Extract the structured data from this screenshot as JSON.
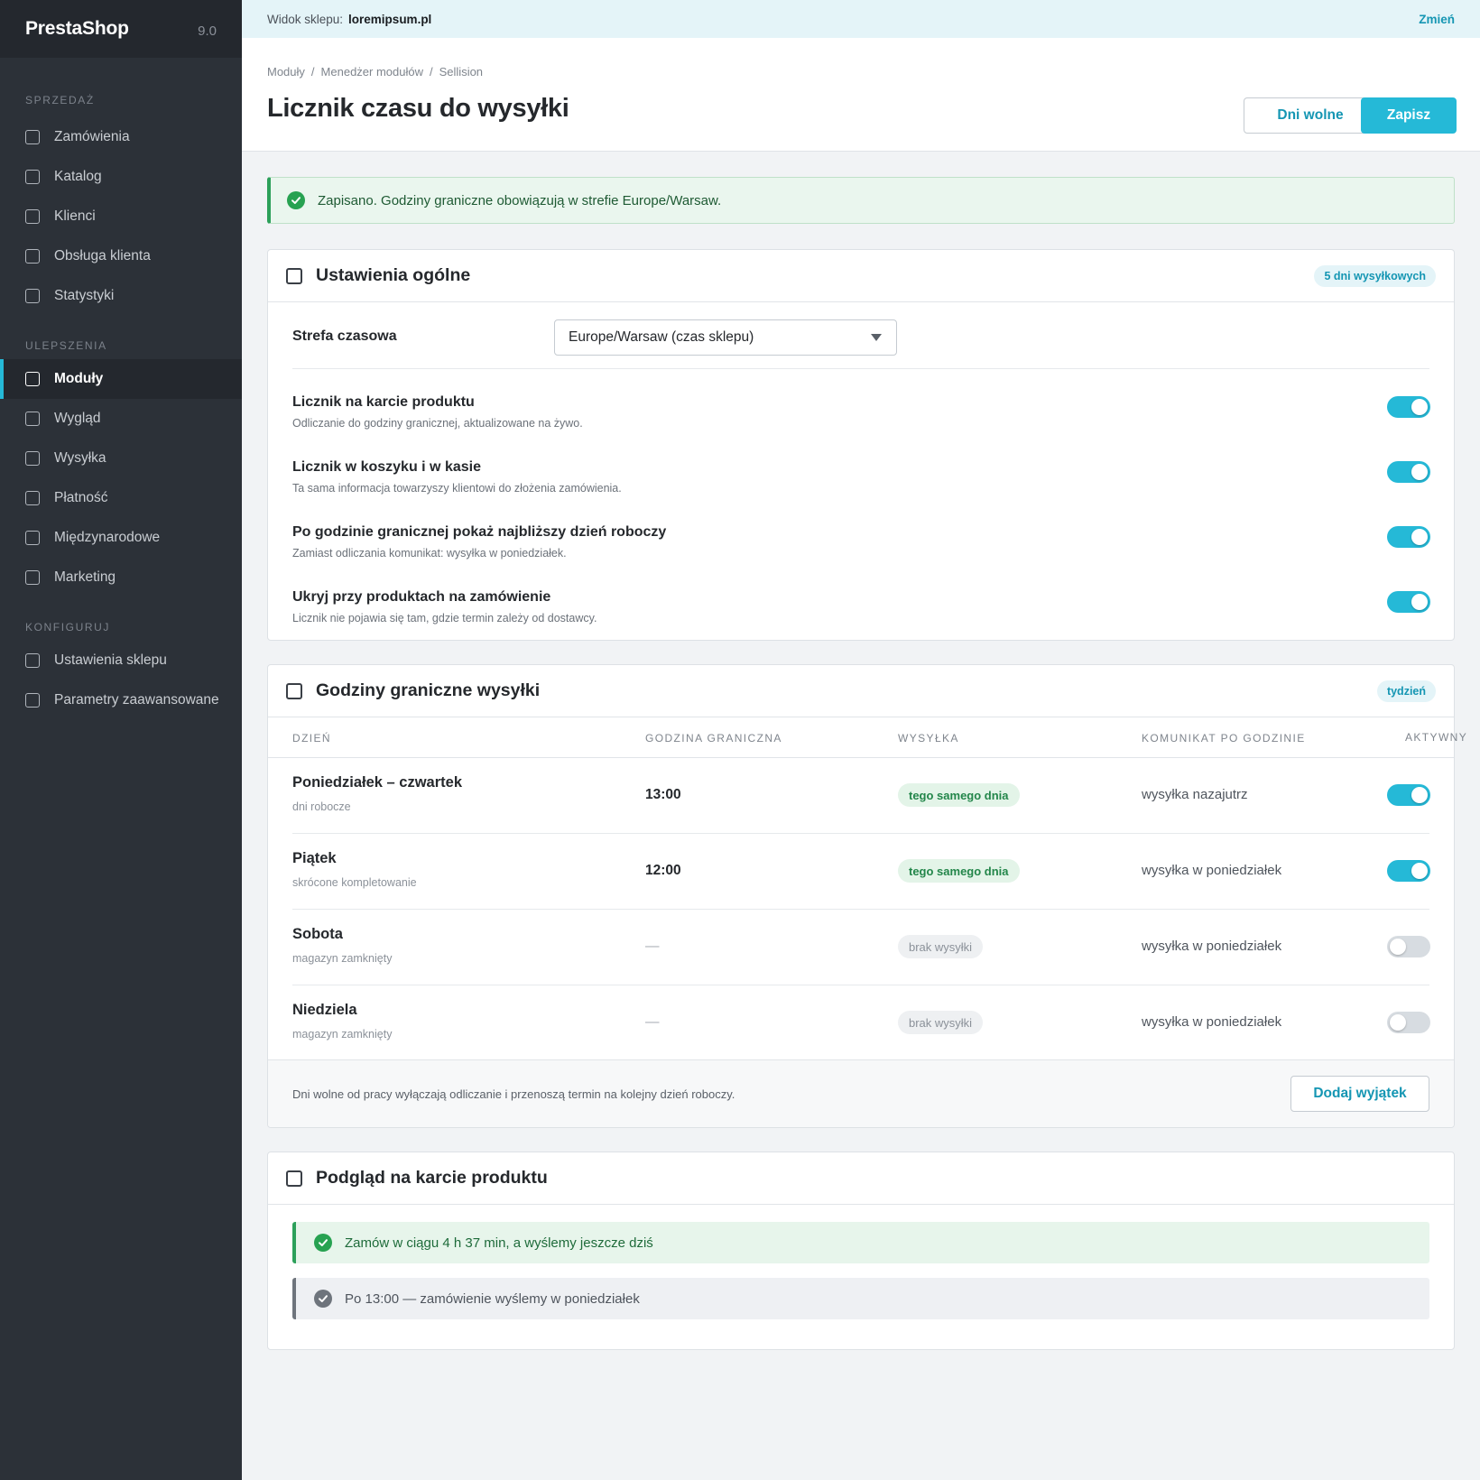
{
  "brand": {
    "name": "PrestaShop",
    "version": "9.0"
  },
  "sidebar": {
    "sections": [
      {
        "title": "SPRZEDAŻ",
        "items": [
          "Zamówienia",
          "Katalog",
          "Klienci",
          "Obsługa klienta",
          "Statystyki"
        ]
      },
      {
        "title": "ULEPSZENIA",
        "items": [
          "Moduły",
          "Wygląd",
          "Wysyłka",
          "Płatność",
          "Międzynarodowe",
          "Marketing"
        ]
      },
      {
        "title": "KONFIGURUJ",
        "items": [
          "Ustawienia sklepu",
          "Parametry zaawansowane"
        ]
      }
    ],
    "active_item": "Moduły"
  },
  "shopbar": {
    "label": "Widok sklepu:",
    "domain": "loremipsum.pl",
    "change": "Zmień"
  },
  "header": {
    "breadcrumb": [
      "Moduły",
      "Menedżer modułów",
      "Sellision"
    ],
    "title": "Licznik czasu do wysyłki",
    "btn_secondary": "Dni wolne",
    "btn_primary": "Zapisz"
  },
  "alert": {
    "text": "Zapisano. Godziny graniczne obowiązują w strefie Europe/Warsaw."
  },
  "general": {
    "title": "Ustawienia ogólne",
    "chip": "5 dni wysyłkowych",
    "timezone_label": "Strefa czasowa",
    "timezone_value": "Europe/Warsaw (czas sklepu)",
    "options": [
      {
        "title": "Licznik na karcie produktu",
        "desc": "Odliczanie do godziny granicznej, aktualizowane na żywo.",
        "on": true
      },
      {
        "title": "Licznik w koszyku i w kasie",
        "desc": "Ta sama informacja towarzyszy klientowi do złożenia zamówienia.",
        "on": true
      },
      {
        "title": "Po godzinie granicznej pokaż najbliższy dzień roboczy",
        "desc": "Zamiast odliczania komunikat: wysyłka w poniedziałek.",
        "on": true
      },
      {
        "title": "Ukryj przy produktach na zamówienie",
        "desc": "Licznik nie pojawia się tam, gdzie termin zależy od dostawcy.",
        "on": true
      }
    ]
  },
  "cutoff": {
    "title": "Godziny graniczne wysyłki",
    "chip": "tydzień",
    "columns": [
      "DZIEŃ",
      "GODZINA GRANICZNA",
      "WYSYŁKA",
      "KOMUNIKAT PO GODZINIE",
      "AKTYWNY"
    ],
    "rows": [
      {
        "day": "Poniedziałek – czwartek",
        "sub": "dni robocze",
        "time": "13:00",
        "shipping": "tego samego dnia",
        "message": "wysyłka nazajutrz",
        "active": true
      },
      {
        "day": "Piątek",
        "sub": "skrócone kompletowanie",
        "time": "12:00",
        "shipping": "tego samego dnia",
        "message": "wysyłka w poniedziałek",
        "active": true
      },
      {
        "day": "Sobota",
        "sub": "magazyn zamknięty",
        "time": "—",
        "shipping": "brak wysyłki",
        "message": "wysyłka w poniedziałek",
        "active": false
      },
      {
        "day": "Niedziela",
        "sub": "magazyn zamknięty",
        "time": "—",
        "shipping": "brak wysyłki",
        "message": "wysyłka w poniedziałek",
        "active": false
      }
    ],
    "footnote": "Dni wolne od pracy wyłączają odliczanie i przenoszą termin na kolejny dzień roboczy.",
    "add_button": "Dodaj wyjątek"
  },
  "preview": {
    "title": "Podgląd na karcie produktu",
    "before": "Zamów w ciągu 4 h 37 min, a wyślemy jeszcze dziś",
    "after": "Po 13:00 — zamówienie wyślemy w poniedziałek"
  },
  "colors": {
    "accent": "#25b9d7",
    "sidebar": "#2c3138",
    "success": "#2ca05a"
  }
}
